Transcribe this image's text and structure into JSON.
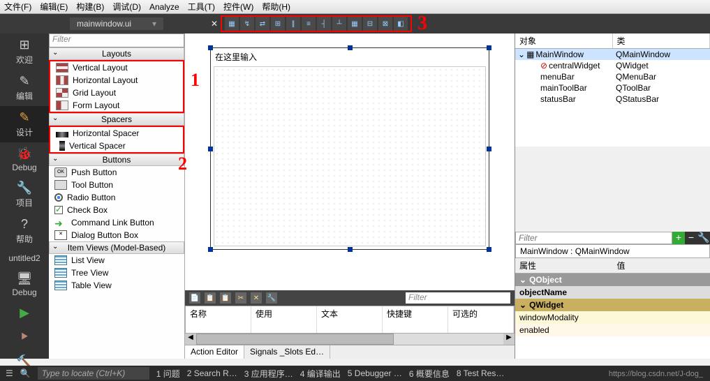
{
  "menus": [
    "文件(F)",
    "编辑(E)",
    "构建(B)",
    "调试(D)",
    "Analyze",
    "工具(T)",
    "控件(W)",
    "帮助(H)"
  ],
  "tab": {
    "title": "mainwindow.ui",
    "close": "▾"
  },
  "annotations": {
    "a1": "1",
    "a2": "2",
    "a3": "3"
  },
  "left_rail": [
    {
      "icon": "⊞",
      "label": "欢迎",
      "cls": ""
    },
    {
      "icon": "✎",
      "label": "编辑",
      "cls": ""
    },
    {
      "icon": "✎",
      "label": "设计",
      "cls": "orange",
      "active": true
    },
    {
      "icon": "🐞",
      "label": "Debug",
      "cls": ""
    },
    {
      "icon": "🔧",
      "label": "项目",
      "cls": ""
    },
    {
      "icon": "?",
      "label": "帮助",
      "cls": ""
    },
    {
      "icon": "",
      "label": "untitled2",
      "cls": ""
    },
    {
      "icon": "",
      "label": "Debug",
      "cls": ""
    },
    {
      "icon": "▶",
      "label": "",
      "cls": "green"
    },
    {
      "icon": "⯈",
      "label": "",
      "cls": "brown"
    },
    {
      "icon": "🔨",
      "label": "",
      "cls": ""
    }
  ],
  "widgets": {
    "filter_placeholder": "Filter",
    "cat_layouts": "Layouts",
    "layouts": [
      "Vertical Layout",
      "Horizontal Layout",
      "Grid Layout",
      "Form Layout"
    ],
    "cat_spacers": "Spacers",
    "spacers": [
      "Horizontal Spacer",
      "Vertical Spacer"
    ],
    "cat_buttons": "Buttons",
    "buttons": [
      "Push Button",
      "Tool Button",
      "Radio Button",
      "Check Box",
      "Command Link Button",
      "Dialog Button Box"
    ],
    "cat_itemviews": "Item Views (Model-Based)",
    "itemviews": [
      "List View",
      "Tree View",
      "Table View"
    ]
  },
  "canvas": {
    "prompt": "在这里输入"
  },
  "action_cols": [
    "名称",
    "使用",
    "文本",
    "快捷键",
    "可选的"
  ],
  "action_filter": "Filter",
  "bottom_tabs": [
    "Action Editor",
    "Signals _Slots Ed…"
  ],
  "objects": {
    "col1": "对象",
    "col2": "类",
    "rows": [
      {
        "n": "MainWindow",
        "c": "QMainWindow",
        "i": 0,
        "sel": true,
        "ico": "▦"
      },
      {
        "n": "centralWidget",
        "c": "QWidget",
        "i": 2,
        "ico": "⊘"
      },
      {
        "n": "menuBar",
        "c": "QMenuBar",
        "i": 2
      },
      {
        "n": "mainToolBar",
        "c": "QToolBar",
        "i": 2
      },
      {
        "n": "statusBar",
        "c": "QStatusBar",
        "i": 2
      }
    ]
  },
  "props": {
    "instance": "MainWindow : QMainWindow",
    "filter": "Filter",
    "col1": "属性",
    "col2": "值",
    "sec1": "QObject",
    "p1": "objectName",
    "sec2": "QWidget",
    "p2": "windowModality",
    "p3": "enabled"
  },
  "status": {
    "locate": "Type to locate (Ctrl+K)",
    "items": [
      "1 问题",
      "2 Search R…",
      "3 应用程序…",
      "4 编译输出",
      "5 Debugger …",
      "6 概要信息",
      "8 Test Res…"
    ]
  },
  "watermark": "https://blog.csdn.net/J-dog_"
}
